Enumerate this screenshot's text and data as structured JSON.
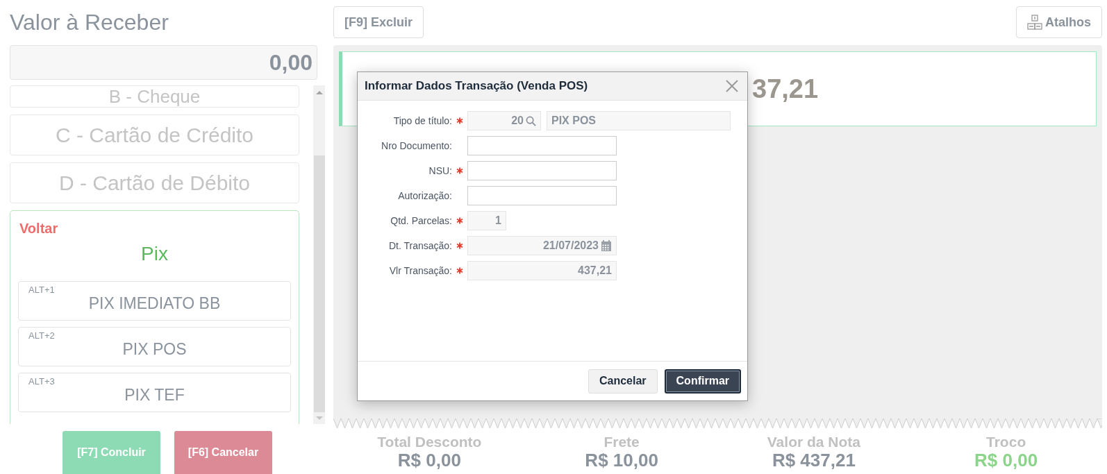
{
  "header": {
    "title": "Valor à Receber",
    "amount": "0,00"
  },
  "toolbar": {
    "delete_button": "[F9] Excluir",
    "shortcuts_button": "Atalhos"
  },
  "payment_methods": [
    {
      "label": "B - Cheque"
    },
    {
      "label": "C - Cartão de Crédito"
    },
    {
      "label": "D - Cartão de Débito"
    }
  ],
  "pix_panel": {
    "back": "Voltar",
    "title": "Pix",
    "options": [
      {
        "shortcut": "ALT+1",
        "label": "PIX IMEDIATO BB"
      },
      {
        "shortcut": "ALT+2",
        "label": "PIX POS"
      },
      {
        "shortcut": "ALT+3",
        "label": "PIX TEF"
      }
    ]
  },
  "payment_card": {
    "amount_fragment": "37,21"
  },
  "dialog": {
    "title": "Informar Dados Transação (Venda POS)",
    "fields": [
      {
        "label": "Tipo de título:",
        "required": true,
        "kind": "lookup",
        "code": "20",
        "value": "PIX POS"
      },
      {
        "label": "Nro Documento:",
        "required": false,
        "kind": "text"
      },
      {
        "label": "NSU:",
        "required": true,
        "kind": "text"
      },
      {
        "label": "Autorização:",
        "required": false,
        "kind": "text"
      },
      {
        "label": "Qtd. Parcelas:",
        "required": true,
        "kind": "short",
        "value": "1"
      },
      {
        "label": "Dt. Transação:",
        "required": true,
        "kind": "date",
        "value": "21/07/2023"
      },
      {
        "label": "Vlr Transação:",
        "required": true,
        "kind": "amount",
        "value": "437,21"
      }
    ],
    "buttons": [
      {
        "label": "Cancelar",
        "primary": false
      },
      {
        "label": "Confirmar",
        "primary": true
      }
    ]
  },
  "actions": [
    {
      "label": "[F7] Concluir",
      "kind": "confirm"
    },
    {
      "label": "[F6] Cancelar",
      "kind": "cancel"
    }
  ],
  "summary": [
    {
      "label": "Total Desconto",
      "value": "R$ 0,00",
      "highlight": false
    },
    {
      "label": "Frete",
      "value": "R$ 10,00",
      "highlight": false
    },
    {
      "label": "Valor da Nota",
      "value": "R$ 437,21",
      "highlight": false
    },
    {
      "label": "Troco",
      "value": "R$ 0,00",
      "highlight": true
    }
  ]
}
